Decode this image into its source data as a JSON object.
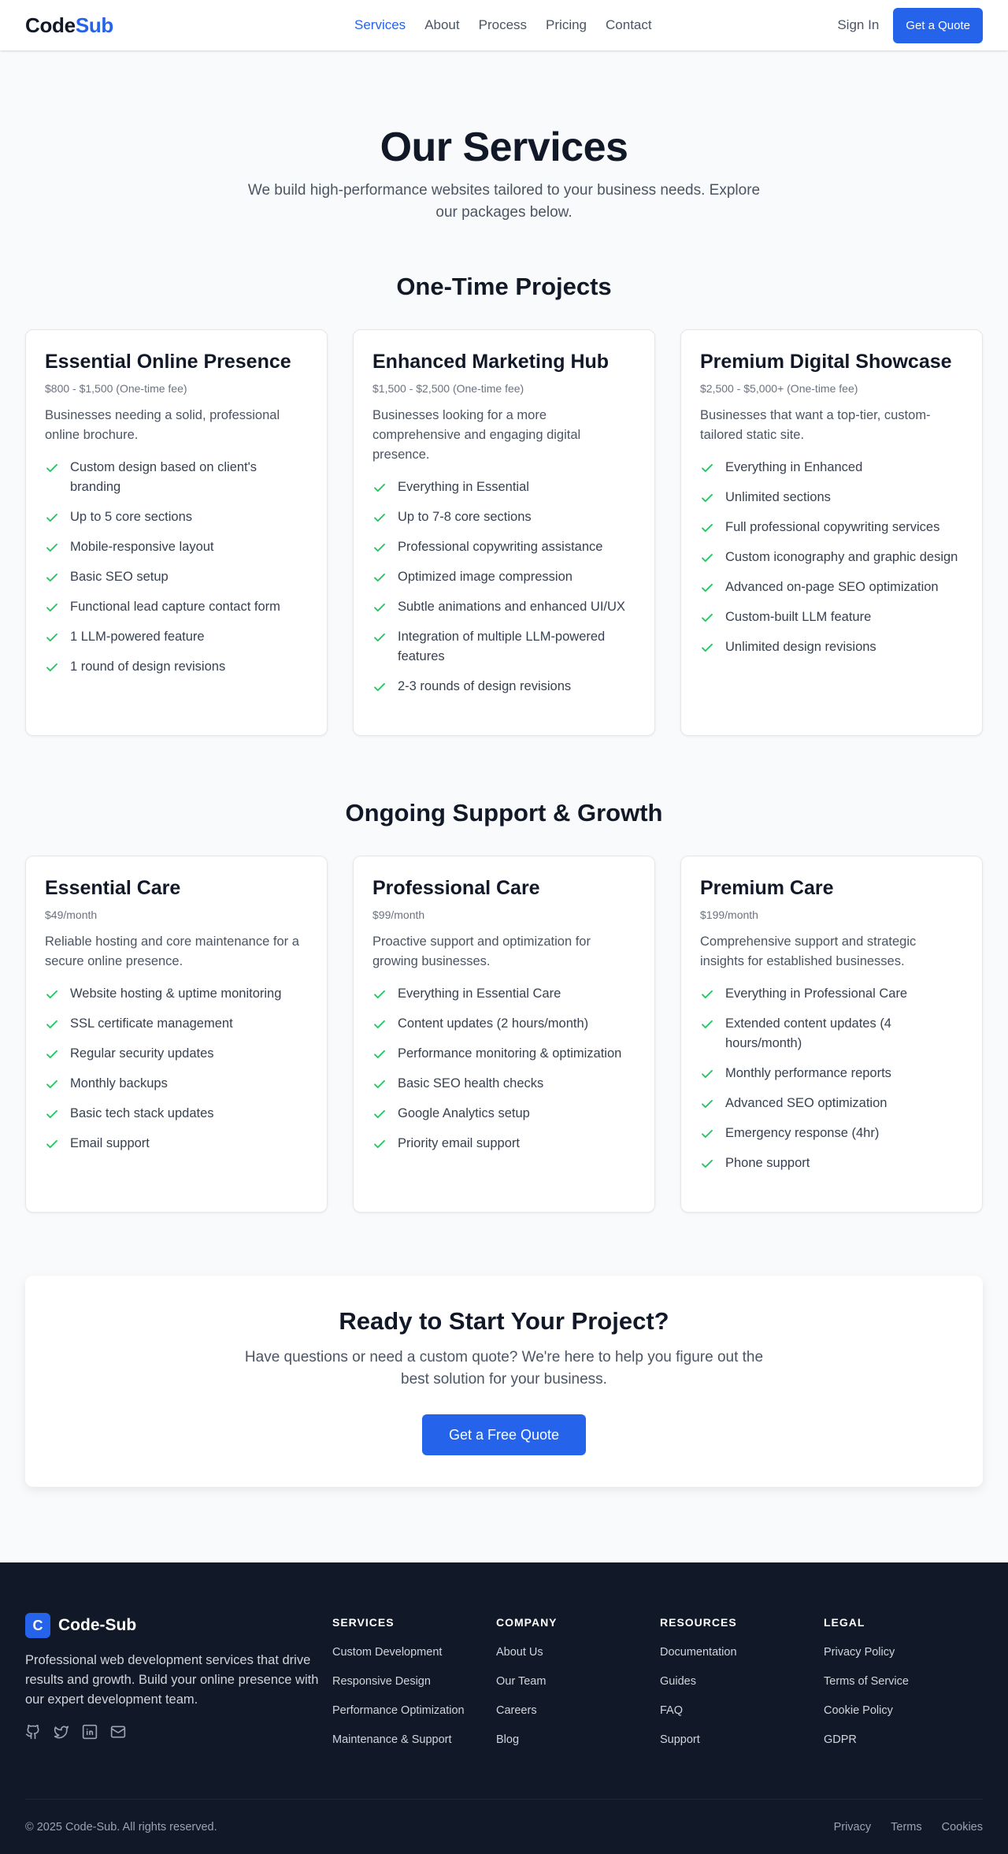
{
  "nav": {
    "logo_main": "Code",
    "logo_accent": "Sub",
    "links": [
      "Services",
      "About",
      "Process",
      "Pricing",
      "Contact"
    ],
    "active_link": "Services",
    "signin": "Sign In",
    "quote_button": "Get a Quote"
  },
  "hero": {
    "title": "Our Services",
    "subtitle": "We build high-performance websites tailored to your business needs. Explore our packages below."
  },
  "one_time": {
    "title": "One-Time Projects",
    "cards": [
      {
        "name": "Essential Online Presence",
        "price": "$800 - $1,500 (One-time fee)",
        "desc": "Businesses needing a solid, professional online brochure.",
        "features": [
          "Custom design based on client's branding",
          "Up to 5 core sections",
          "Mobile-responsive layout",
          "Basic SEO setup",
          "Functional lead capture contact form",
          "1 LLM-powered feature",
          "1 round of design revisions"
        ]
      },
      {
        "name": "Enhanced Marketing Hub",
        "price": "$1,500 - $2,500 (One-time fee)",
        "desc": "Businesses looking for a more comprehensive and engaging digital presence.",
        "features": [
          "Everything in Essential",
          "Up to 7-8 core sections",
          "Professional copywriting assistance",
          "Optimized image compression",
          "Subtle animations and enhanced UI/UX",
          "Integration of multiple LLM-powered features",
          "2-3 rounds of design revisions"
        ]
      },
      {
        "name": "Premium Digital Showcase",
        "price": "$2,500 - $5,000+ (One-time fee)",
        "desc": "Businesses that want a top-tier, custom-tailored static site.",
        "features": [
          "Everything in Enhanced",
          "Unlimited sections",
          "Full professional copywriting services",
          "Custom iconography and graphic design",
          "Advanced on-page SEO optimization",
          "Custom-built LLM feature",
          "Unlimited design revisions"
        ]
      }
    ]
  },
  "ongoing": {
    "title": "Ongoing Support & Growth",
    "cards": [
      {
        "name": "Essential Care",
        "price": "$49/month",
        "desc": "Reliable hosting and core maintenance for a secure online presence.",
        "features": [
          "Website hosting & uptime monitoring",
          "SSL certificate management",
          "Regular security updates",
          "Monthly backups",
          "Basic tech stack updates",
          "Email support"
        ]
      },
      {
        "name": "Professional Care",
        "price": "$99/month",
        "desc": "Proactive support and optimization for growing businesses.",
        "features": [
          "Everything in Essential Care",
          "Content updates (2 hours/month)",
          "Performance monitoring & optimization",
          "Basic SEO health checks",
          "Google Analytics setup",
          "Priority email support"
        ]
      },
      {
        "name": "Premium Care",
        "price": "$199/month",
        "desc": "Comprehensive support and strategic insights for established businesses.",
        "features": [
          "Everything in Professional Care",
          "Extended content updates (4 hours/month)",
          "Monthly performance reports",
          "Advanced SEO optimization",
          "Emergency response (4hr)",
          "Phone support"
        ]
      }
    ]
  },
  "cta": {
    "title": "Ready to Start Your Project?",
    "text": "Have questions or need a custom quote? We're here to help you figure out the best solution for your business.",
    "button": "Get a Free Quote"
  },
  "footer": {
    "badge": "C",
    "brand": "Code-Sub",
    "text": "Professional web development services that drive results and growth. Build your online presence with our expert development team.",
    "social_icons": [
      "github-icon",
      "twitter-icon",
      "linkedin-icon",
      "mail-icon"
    ],
    "columns": [
      {
        "title": "SERVICES",
        "links": [
          "Custom Development",
          "Responsive Design",
          "Performance Optimization",
          "Maintenance & Support"
        ]
      },
      {
        "title": "COMPANY",
        "links": [
          "About Us",
          "Our Team",
          "Careers",
          "Blog"
        ]
      },
      {
        "title": "RESOURCES",
        "links": [
          "Documentation",
          "Guides",
          "FAQ",
          "Support"
        ]
      },
      {
        "title": "LEGAL",
        "links": [
          "Privacy Policy",
          "Terms of Service",
          "Cookie Policy",
          "GDPR"
        ]
      }
    ],
    "copyright": "© 2025 Code-Sub. All rights reserved.",
    "bottom_links": [
      "Privacy",
      "Terms",
      "Cookies"
    ]
  },
  "colors": {
    "accent": "#2563eb",
    "check": "#22c55e",
    "footer_bg": "#111827",
    "page_bg": "#f9fafb"
  }
}
